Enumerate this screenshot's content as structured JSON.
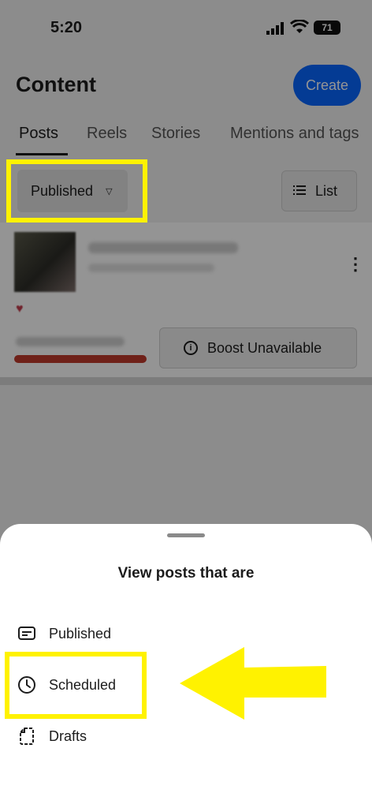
{
  "status_bar": {
    "time": "5:20",
    "battery": "71"
  },
  "header": {
    "title": "Content",
    "create_label": "Create"
  },
  "tabs": [
    {
      "label": "Posts",
      "active": true
    },
    {
      "label": "Reels",
      "active": false
    },
    {
      "label": "Stories",
      "active": false
    },
    {
      "label": "Mentions and tags",
      "active": false
    }
  ],
  "filter": {
    "selected": "Published",
    "view_label": "List"
  },
  "post": {
    "boost_label": "Boost Unavailable"
  },
  "sheet": {
    "title": "View posts that are",
    "options": [
      {
        "label": "Published",
        "icon": "message-square-icon"
      },
      {
        "label": "Scheduled",
        "icon": "clock-icon"
      },
      {
        "label": "Drafts",
        "icon": "file-icon"
      }
    ]
  },
  "colors": {
    "accent": "#0866ff",
    "highlight": "#fff200",
    "progress": "#c0392b"
  }
}
